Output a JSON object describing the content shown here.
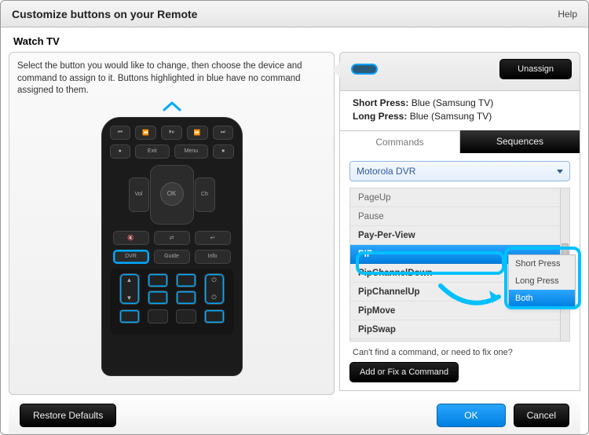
{
  "titlebar": {
    "title": "Customize buttons on your Remote",
    "help": "Help"
  },
  "subhead": "Watch TV",
  "instructions": "Select the button you would like to change, then choose the device and command to assign to it. Buttons highlighted in blue have no command assigned to them.",
  "remote": {
    "ok": "OK",
    "dvr": "DVR",
    "guide": "Guide",
    "info": "Info",
    "exit": "Exit",
    "menu": "Menu",
    "vol": "Vol"
  },
  "right": {
    "unassign": "Unassign",
    "short_label": "Short Press:",
    "short_value": "Blue (Samsung TV)",
    "long_label": "Long Press:",
    "long_value": "Blue (Samsung TV)"
  },
  "tabs": {
    "commands": "Commands",
    "sequences": "Sequences"
  },
  "device_dropdown": {
    "selected": "Motorola DVR"
  },
  "commands": {
    "c0": "PageUp",
    "c1": "Pause",
    "c2": "Pay-Per-View",
    "c3": "PIP",
    "c4": "PipChannelDown",
    "c5": "PipChannelUp",
    "c6": "PipMove",
    "c7": "PipSwap"
  },
  "pressmenu": {
    "o0": "Short Press",
    "o1": "Long Press",
    "o2": "Both"
  },
  "hint": "Can't find a command, or need to fix one?",
  "addfix": "Add or Fix a Command",
  "footer": {
    "restore": "Restore Defaults",
    "ok": "OK",
    "cancel": "Cancel"
  }
}
